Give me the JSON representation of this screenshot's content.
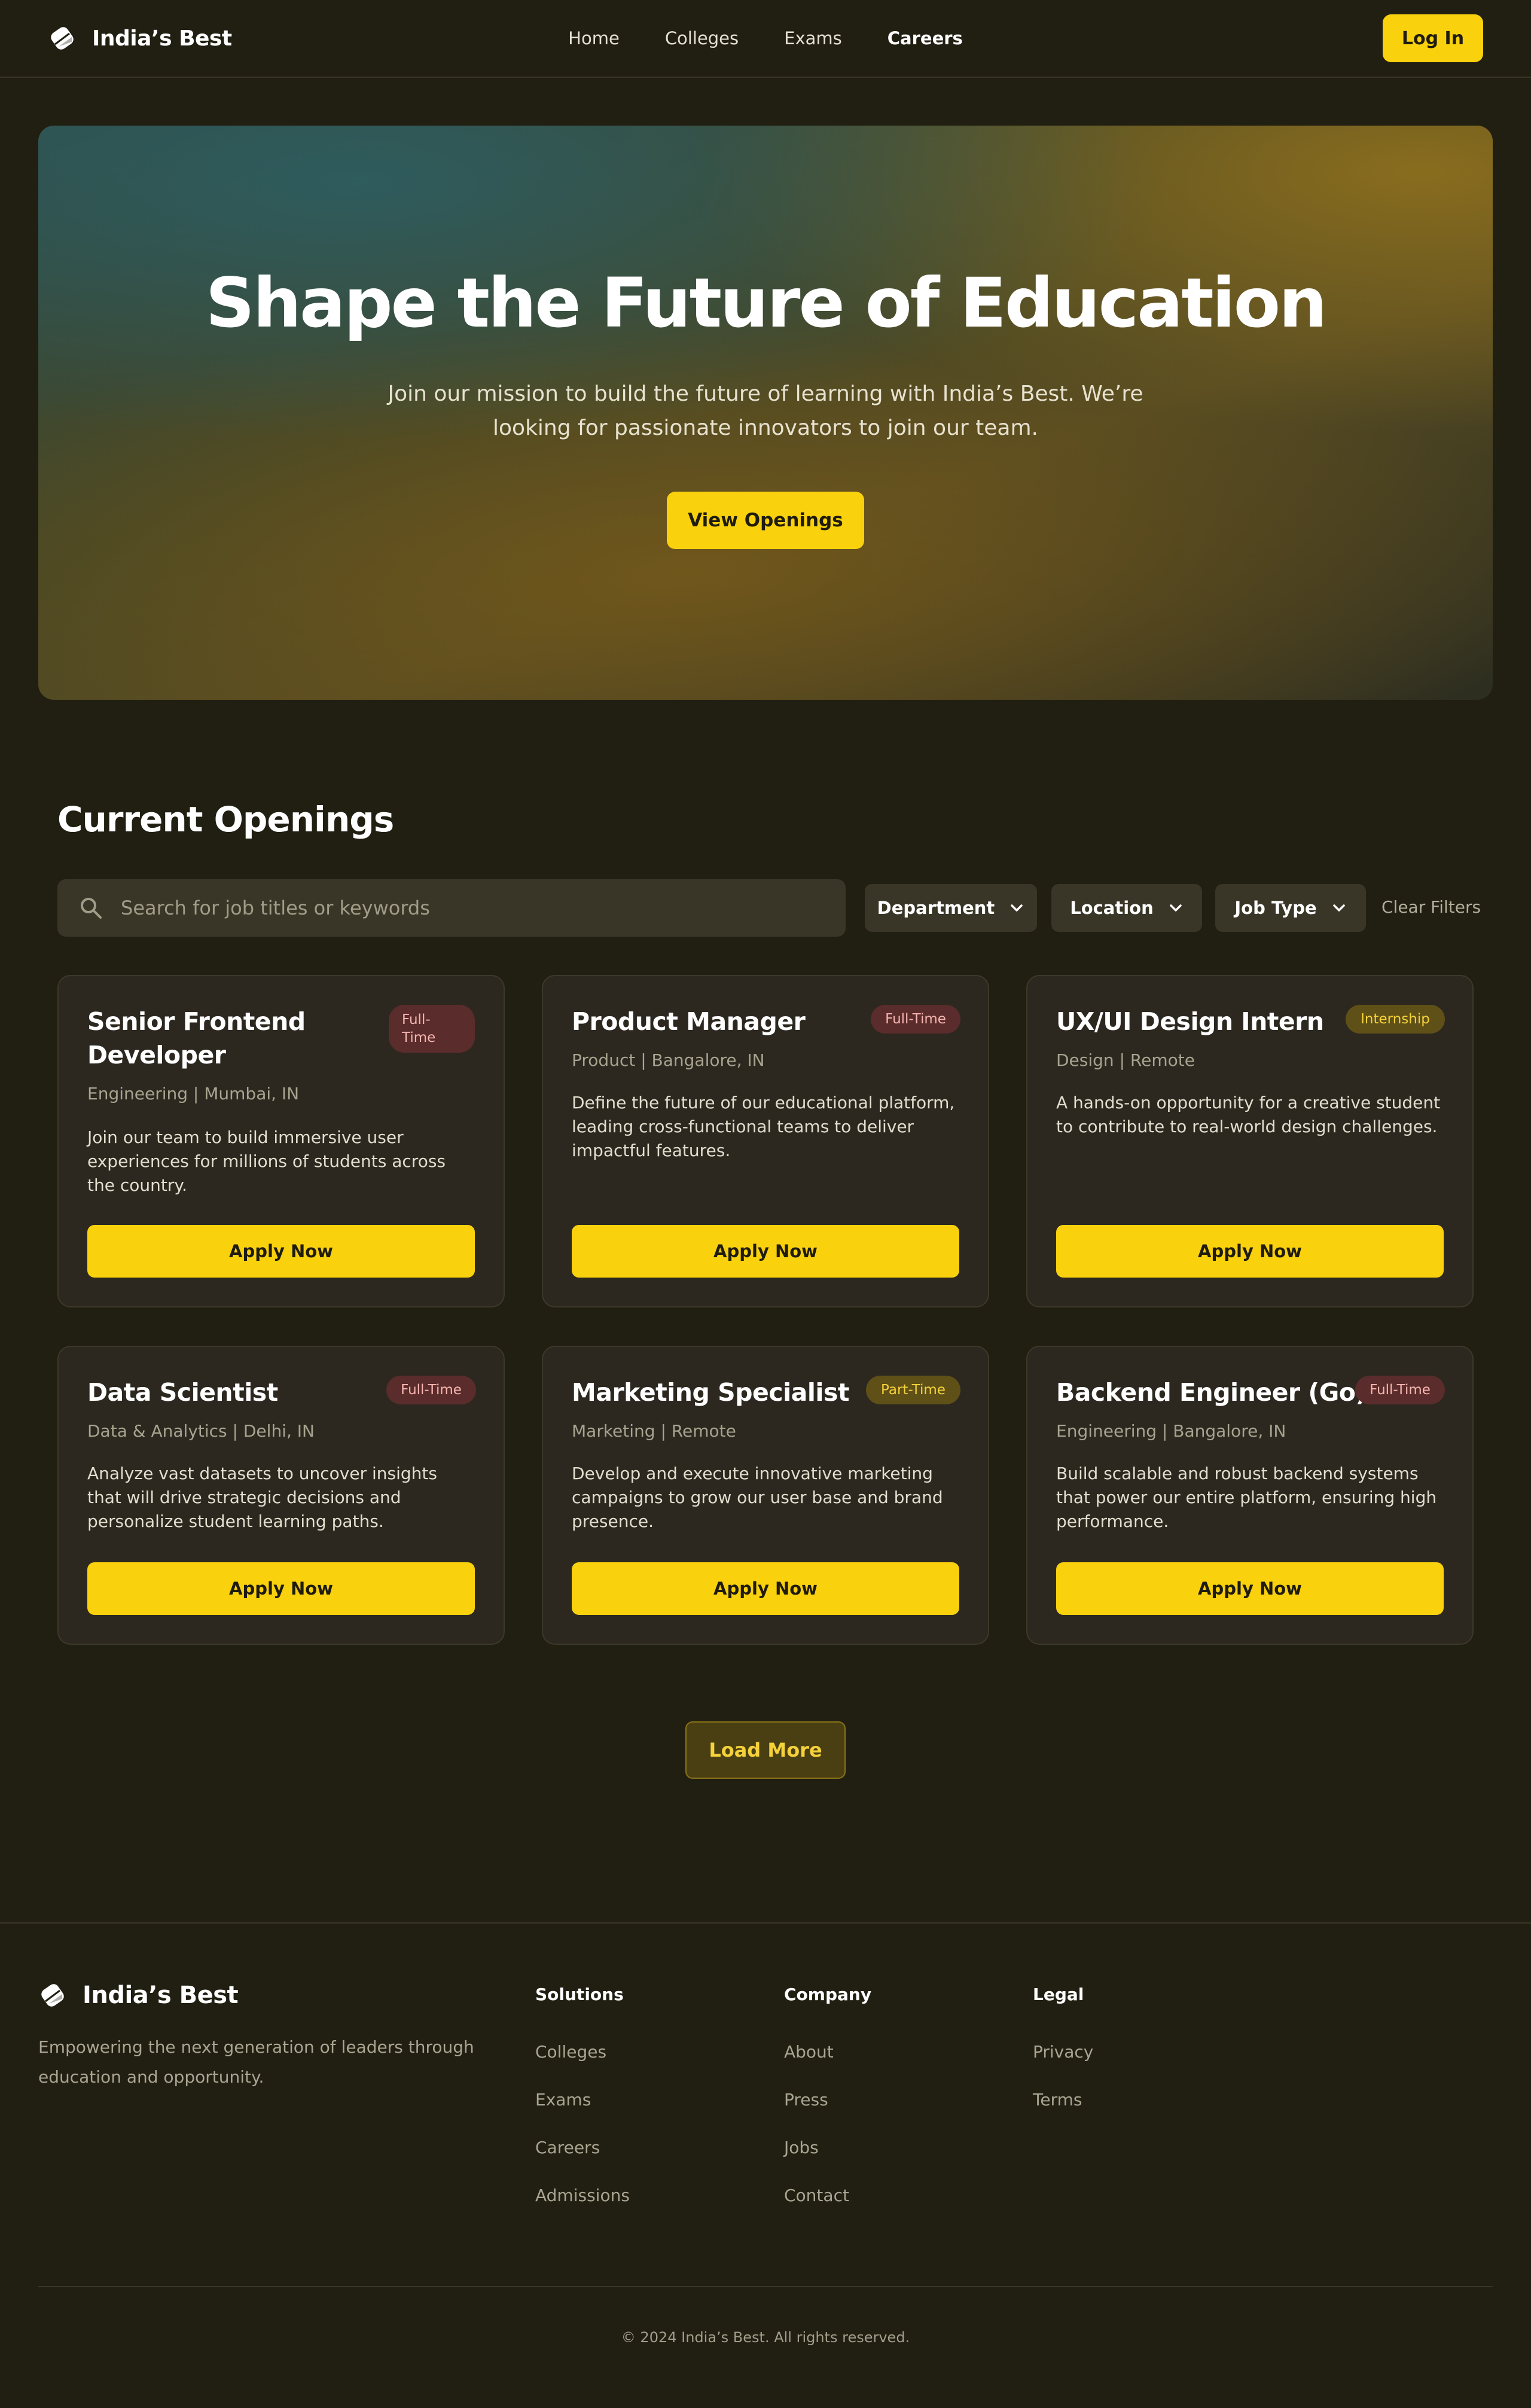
{
  "brand": {
    "name": "India’s Best",
    "icon": "logo-tag-icon"
  },
  "nav": {
    "links": [
      {
        "label": "Home"
      },
      {
        "label": "Colleges"
      },
      {
        "label": "Exams"
      },
      {
        "label": "Careers",
        "active": true
      }
    ],
    "login_label": "Log In"
  },
  "hero": {
    "title": "Shape the Future of Education",
    "subtitle": "Join our mission to build the future of learning with India’s Best. We’re looking for passionate innovators to join our team.",
    "cta_label": "View Openings"
  },
  "openings": {
    "title": "Current Openings",
    "search_placeholder": "Search for job titles or keywords",
    "filters": [
      "Department",
      "Location",
      "Job Type"
    ],
    "clear_label": "Clear Filters",
    "apply_label": "Apply Now",
    "load_more_label": "Load More",
    "jobs": [
      {
        "title": "Senior Frontend Developer",
        "badge": "Full-Time",
        "meta": "Engineering | Mumbai, IN",
        "description": "Join our team to build immersive user experiences for millions of students across the country."
      },
      {
        "title": "Product Manager",
        "badge": "Full-Time",
        "meta": "Product | Bangalore, IN",
        "description": "Define the future of our educational platform, leading cross-functional teams to deliver impactful features."
      },
      {
        "title": "UX/UI Design Intern",
        "badge": "Internship",
        "meta": "Design | Remote",
        "description": "A hands-on opportunity for a creative student to contribute to real-world design challenges."
      },
      {
        "title": "Data Scientist",
        "badge": "Full-Time",
        "meta": "Data & Analytics | Delhi, IN",
        "description": "Analyze vast datasets to uncover insights that will drive strategic decisions and personalize student learning paths."
      },
      {
        "title": "Marketing Specialist",
        "badge": "Part-Time",
        "meta": "Marketing | Remote",
        "description": "Develop and execute innovative marketing campaigns to grow our user base and brand presence."
      },
      {
        "title": "Backend Engineer (Go)",
        "badge": "Full-Time",
        "meta": "Engineering | Bangalore, IN",
        "description": "Build scalable and robust backend systems that power our entire platform, ensuring high performance."
      }
    ]
  },
  "footer": {
    "tagline": "Empowering the next generation of leaders through education and opportunity.",
    "columns": [
      {
        "title": "Solutions",
        "links": [
          "Colleges",
          "Exams",
          "Careers",
          "Admissions"
        ]
      },
      {
        "title": "Company",
        "links": [
          "About",
          "Press",
          "Jobs",
          "Contact"
        ]
      },
      {
        "title": "Legal",
        "links": [
          "Privacy",
          "Terms"
        ]
      }
    ],
    "copyright": "© 2024 India’s Best. All rights reserved."
  },
  "colors": {
    "accent": "#f9d10c",
    "background": "#211e12",
    "card": "#2c2820",
    "badge_full": "#5a2c2b",
    "badge_part": "#5f5018"
  }
}
